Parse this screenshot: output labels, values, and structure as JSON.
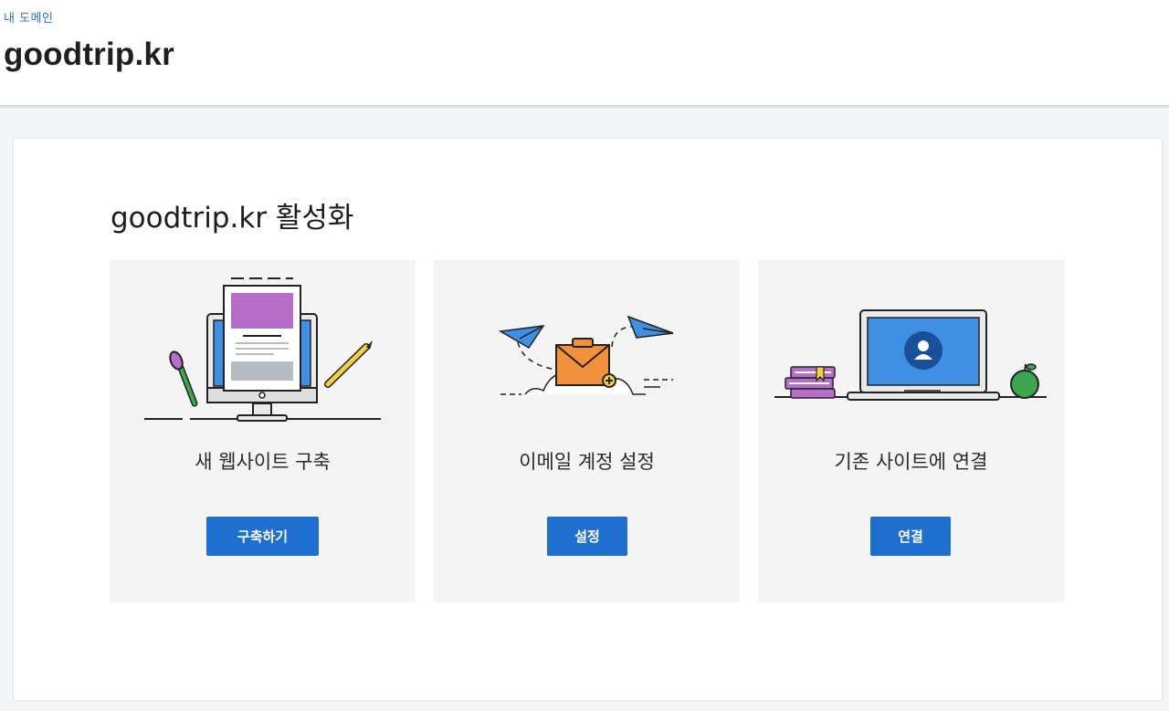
{
  "header": {
    "breadcrumb": "내 도메인",
    "title": "goodtrip.kr"
  },
  "main": {
    "section_title": "goodtrip.kr 활성화",
    "cards": [
      {
        "label": "새 웹사이트 구축",
        "button": "구축하기",
        "icon": "website-builder-illustration"
      },
      {
        "label": "이메일 계정 설정",
        "button": "설정",
        "icon": "email-setup-illustration"
      },
      {
        "label": "기존 사이트에 연결",
        "button": "연결",
        "icon": "connect-site-illustration"
      }
    ]
  },
  "colors": {
    "accent": "#1f6fd1",
    "link": "#1f72c8",
    "card_bg": "#f4f4f4",
    "page_bg": "#f3f5f7"
  }
}
